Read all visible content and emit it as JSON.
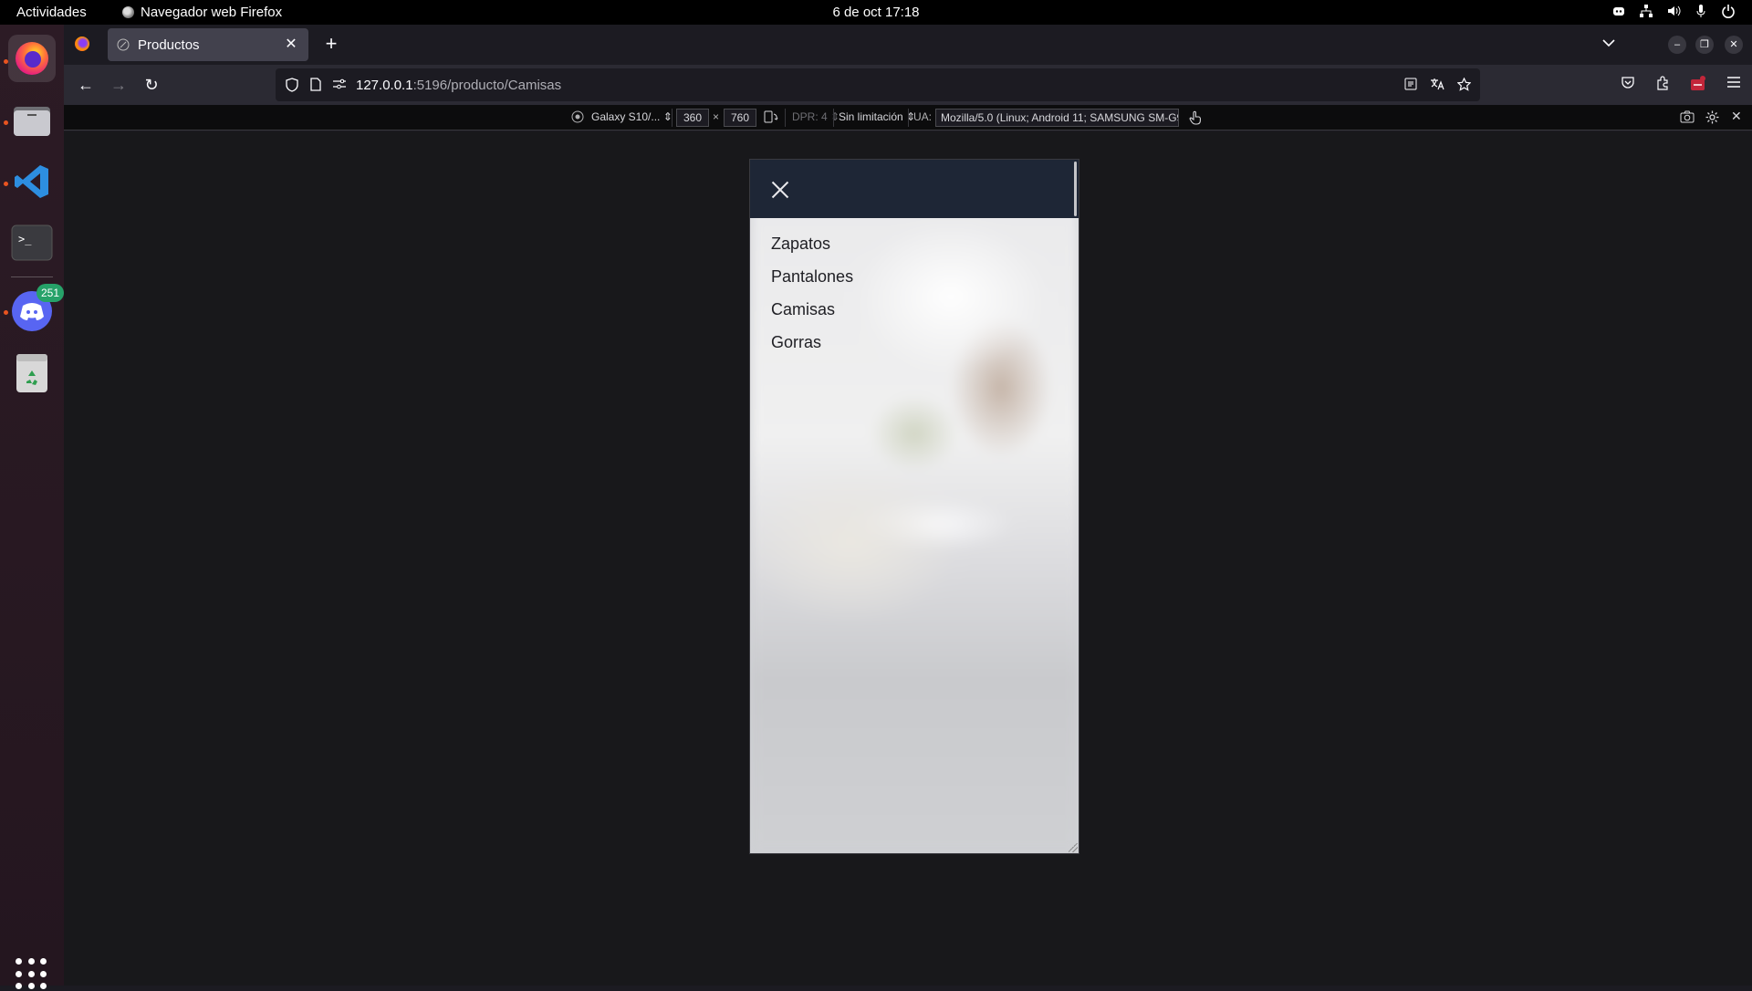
{
  "topbar": {
    "activities": "Actividades",
    "app_name": "Navegador web Firefox",
    "clock": "6 de oct  17:18"
  },
  "dock": {
    "items": [
      {
        "name": "firefox"
      },
      {
        "name": "files"
      },
      {
        "name": "vscode"
      },
      {
        "name": "terminal"
      },
      {
        "name": "discord",
        "badge": "251"
      },
      {
        "name": "trash"
      }
    ]
  },
  "browser": {
    "tab_title": "Productos",
    "url_host": "127.0.0.1",
    "url_rest": ":5196/producto/Camisas"
  },
  "rdm": {
    "device": "Galaxy S10/...",
    "width": "360",
    "times": "×",
    "height": "760",
    "dpr": "DPR: 4",
    "throttle": "Sin limitación",
    "ua_label": "UA:",
    "ua_value": "Mozilla/5.0 (Linux; Android 11; SAMSUNG SM-G97"
  },
  "page": {
    "menu_items": [
      "Zapatos",
      "Pantalones",
      "Camisas",
      "Gorras"
    ]
  },
  "colors": {
    "header_bg": "#1e2636",
    "accent": "#e95420"
  }
}
